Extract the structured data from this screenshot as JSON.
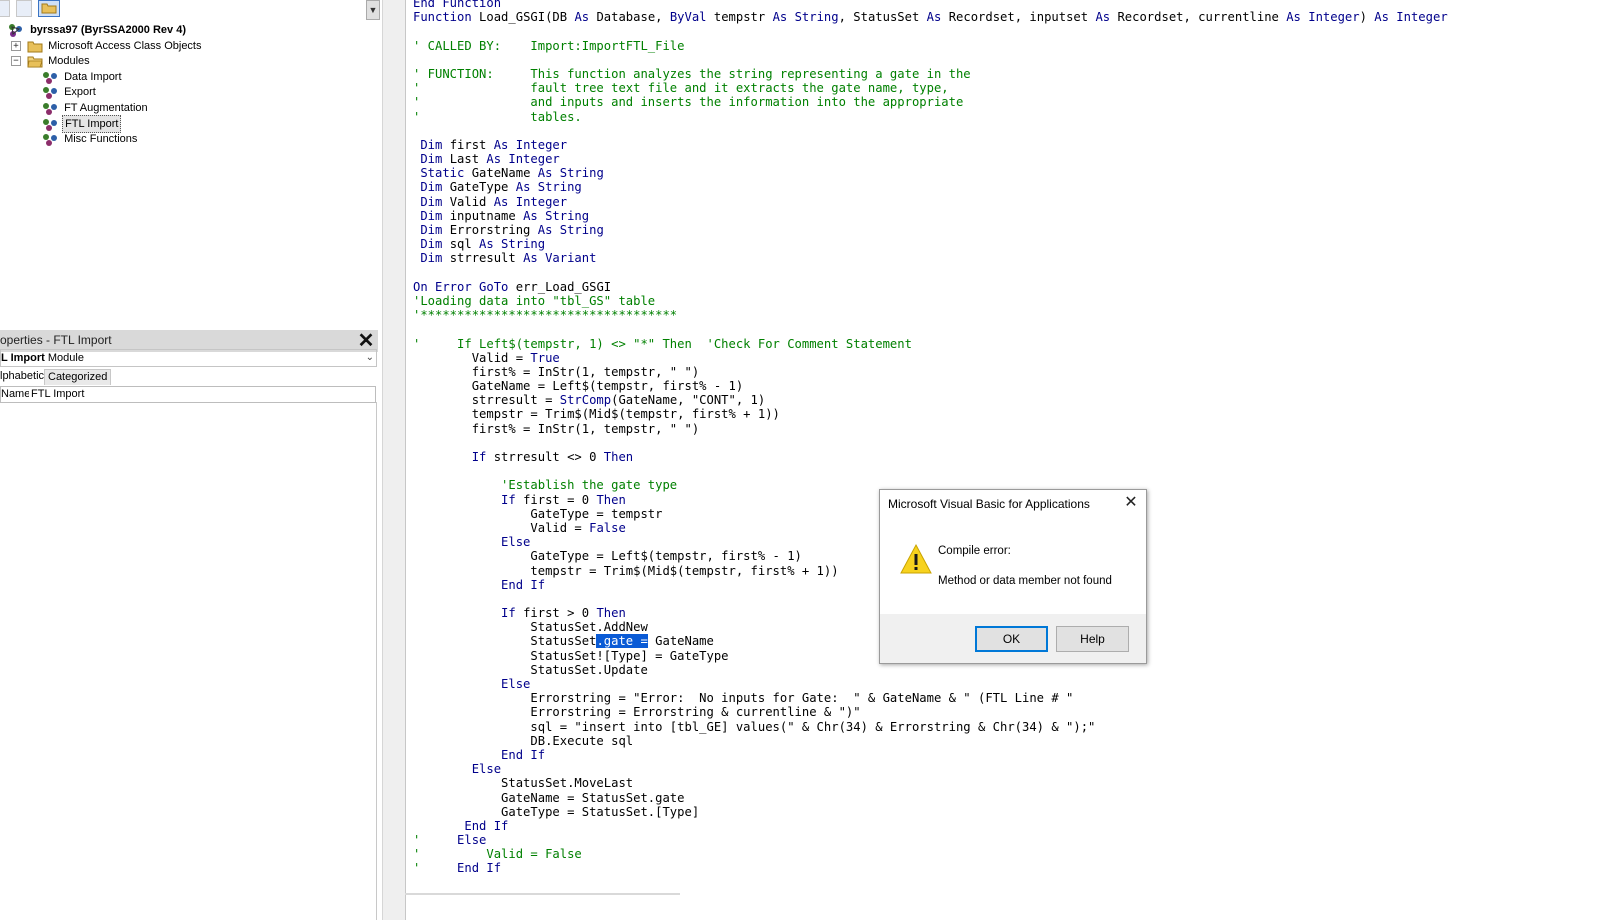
{
  "project_tree": {
    "root_label": "byrssa97 (ByrSSA2000 Rev 4)",
    "folders": [
      {
        "label": "Microsoft Access Class Objects",
        "expander": "+"
      },
      {
        "label": "Modules",
        "expander": "−"
      }
    ],
    "modules": [
      {
        "label": "Data Import",
        "selected": false
      },
      {
        "label": "Export",
        "selected": false
      },
      {
        "label": "FT Augmentation",
        "selected": false
      },
      {
        "label": "FTL Import",
        "selected": true
      },
      {
        "label": "Misc Functions",
        "selected": false
      }
    ]
  },
  "properties": {
    "title": "operties - FTL Import",
    "close_glyph": "✕",
    "object_name": "L Import",
    "object_type": "Module",
    "tabs": [
      "lphabetic",
      "Categorized"
    ],
    "row_name": "Name)",
    "row_value": "FTL Import"
  },
  "code_lines": [
    [
      [
        "kw",
        "End Function"
      ]
    ],
    [
      [
        "kw",
        "Function "
      ],
      [
        "tx",
        "Load_GSGI(DB "
      ],
      [
        "kw",
        "As "
      ],
      [
        "tx",
        "Database, "
      ],
      [
        "kw",
        "ByVal "
      ],
      [
        "tx",
        "tempstr "
      ],
      [
        "kw",
        "As String"
      ],
      [
        "tx",
        ", StatusSet "
      ],
      [
        "kw",
        "As "
      ],
      [
        "tx",
        "Recordset, inputset "
      ],
      [
        "kw",
        "As "
      ],
      [
        "tx",
        "Recordset, currentline "
      ],
      [
        "kw",
        "As Integer"
      ],
      [
        "tx",
        ") "
      ],
      [
        "kw",
        "As Integer"
      ]
    ],
    [],
    [
      [
        "cm",
        "' CALLED BY:    Import:ImportFTL_File"
      ]
    ],
    [],
    [
      [
        "cm",
        "' FUNCTION:     This function analyzes the string representing a gate in the"
      ]
    ],
    [
      [
        "cm",
        "'               fault tree text file and it extracts the gate name, type,"
      ]
    ],
    [
      [
        "cm",
        "'               and inputs and inserts the information into the appropriate"
      ]
    ],
    [
      [
        "cm",
        "'               tables."
      ]
    ],
    [],
    [
      [
        "kw",
        " Dim "
      ],
      [
        "tx",
        "first "
      ],
      [
        "kw",
        "As Integer"
      ]
    ],
    [
      [
        "kw",
        " Dim "
      ],
      [
        "tx",
        "Last "
      ],
      [
        "kw",
        "As Integer"
      ]
    ],
    [
      [
        "kw",
        " Static "
      ],
      [
        "tx",
        "GateName "
      ],
      [
        "kw",
        "As String"
      ]
    ],
    [
      [
        "kw",
        " Dim "
      ],
      [
        "tx",
        "GateType "
      ],
      [
        "kw",
        "As String"
      ]
    ],
    [
      [
        "kw",
        " Dim "
      ],
      [
        "tx",
        "Valid "
      ],
      [
        "kw",
        "As Integer"
      ]
    ],
    [
      [
        "kw",
        " Dim "
      ],
      [
        "tx",
        "inputname "
      ],
      [
        "kw",
        "As String"
      ]
    ],
    [
      [
        "kw",
        " Dim "
      ],
      [
        "tx",
        "Errorstring "
      ],
      [
        "kw",
        "As String"
      ]
    ],
    [
      [
        "kw",
        " Dim "
      ],
      [
        "tx",
        "sql "
      ],
      [
        "kw",
        "As String"
      ]
    ],
    [
      [
        "kw",
        " Dim "
      ],
      [
        "tx",
        "strresult "
      ],
      [
        "kw",
        "As Variant"
      ]
    ],
    [],
    [
      [
        "kw",
        "On Error GoTo "
      ],
      [
        "tx",
        "err_Load_GSGI"
      ]
    ],
    [
      [
        "cm",
        "'Loading data into \"tbl_GS\" table"
      ]
    ],
    [
      [
        "cm",
        "'***********************************"
      ]
    ],
    [],
    [
      [
        "cm",
        "'     If Left$(tempstr, 1) <> \"*\" Then  'Check For Comment Statement"
      ]
    ],
    [
      [
        "tx",
        "        Valid = "
      ],
      [
        "kw",
        "True"
      ]
    ],
    [
      [
        "tx",
        "        first% = InStr(1, tempstr, \" \")"
      ]
    ],
    [
      [
        "tx",
        "        GateName = Left$(tempstr, first% - 1)"
      ]
    ],
    [
      [
        "tx",
        "        strresult = "
      ],
      [
        "kw",
        "StrComp"
      ],
      [
        "tx",
        "(GateName, \"CONT\", 1)"
      ]
    ],
    [
      [
        "tx",
        "        tempstr = Trim$(Mid$(tempstr, first% + 1))"
      ]
    ],
    [
      [
        "tx",
        "        first% = InStr(1, tempstr, \" \")"
      ]
    ],
    [],
    [
      [
        "kw",
        "        If "
      ],
      [
        "tx",
        "strresult <> 0 "
      ],
      [
        "kw",
        "Then"
      ]
    ],
    [],
    [
      [
        "cm",
        "            'Establish the gate type"
      ]
    ],
    [
      [
        "kw",
        "            If "
      ],
      [
        "tx",
        "first = 0 "
      ],
      [
        "kw",
        "Then"
      ]
    ],
    [
      [
        "tx",
        "                GateType = tempstr"
      ]
    ],
    [
      [
        "tx",
        "                Valid = "
      ],
      [
        "kw",
        "False"
      ]
    ],
    [
      [
        "kw",
        "            Else"
      ]
    ],
    [
      [
        "tx",
        "                GateType = Left$(tempstr, first% - 1)"
      ]
    ],
    [
      [
        "tx",
        "                tempstr = Trim$(Mid$(tempstr, first% + 1))"
      ]
    ],
    [
      [
        "kw",
        "            End If"
      ]
    ],
    [],
    [
      [
        "kw",
        "            If "
      ],
      [
        "tx",
        "first > 0 "
      ],
      [
        "kw",
        "Then"
      ]
    ],
    [
      [
        "tx",
        "                StatusSet.AddNew"
      ]
    ],
    [
      [
        "tx",
        "                StatusSet"
      ],
      [
        "hl",
        ".gate ="
      ],
      [
        "tx",
        " GateName"
      ]
    ],
    [
      [
        "tx",
        "                StatusSet![Type] = GateType"
      ]
    ],
    [
      [
        "tx",
        "                StatusSet.Update"
      ]
    ],
    [
      [
        "kw",
        "            Else"
      ]
    ],
    [
      [
        "tx",
        "                Errorstring = \"Error:  No inputs for Gate:  \" & GateName & \" (FTL Line # \""
      ]
    ],
    [
      [
        "tx",
        "                Errorstring = Errorstring & currentline & \")\""
      ]
    ],
    [
      [
        "tx",
        "                sql = \"insert into [tbl_GE] values(\" & Chr(34) & Errorstring & Chr(34) & \");\""
      ]
    ],
    [
      [
        "tx",
        "                DB.Execute sql"
      ]
    ],
    [
      [
        "kw",
        "            End If"
      ]
    ],
    [
      [
        "kw",
        "        Else"
      ]
    ],
    [
      [
        "tx",
        "            StatusSet.MoveLast"
      ]
    ],
    [
      [
        "tx",
        "            GateName = StatusSet.gate"
      ]
    ],
    [
      [
        "tx",
        "            GateType = StatusSet.[Type]"
      ]
    ],
    [
      [
        "kw",
        "       End If"
      ]
    ],
    [
      [
        "cm",
        "'"
      ],
      [
        "kw",
        "     Else"
      ]
    ],
    [
      [
        "cm",
        "'"
      ],
      [
        "cm",
        "         Valid = False"
      ]
    ],
    [
      [
        "cm",
        "'"
      ],
      [
        "kw",
        "     End If"
      ]
    ]
  ],
  "dialog": {
    "title": "Microsoft Visual Basic for Applications",
    "close_glyph": "✕",
    "icon": "warning-icon",
    "error_title": "Compile error:",
    "message": "Method or data member not found",
    "ok_label": "OK",
    "help_label": "Help"
  },
  "colors": {
    "keyword": "#00008b",
    "comment": "#008000",
    "selection": "#0a5bd6"
  }
}
